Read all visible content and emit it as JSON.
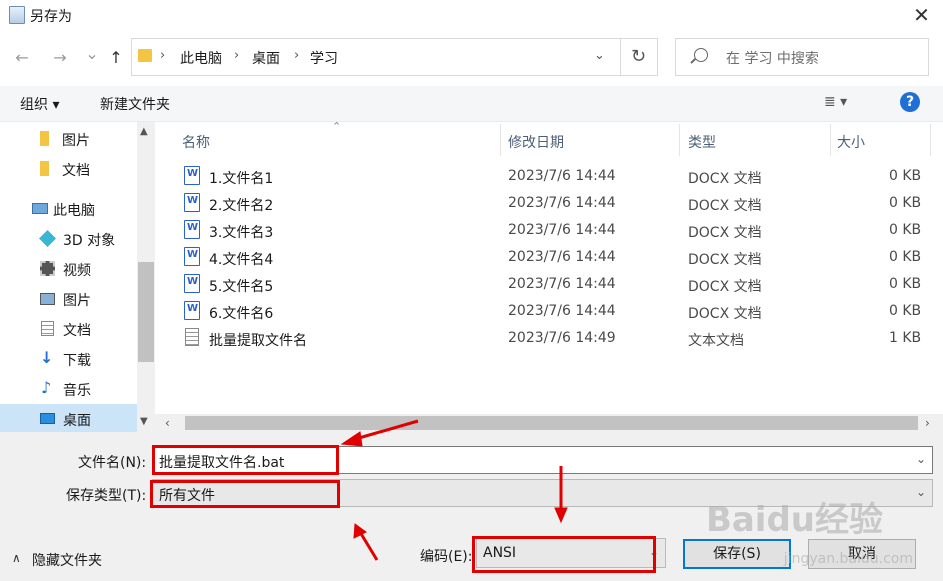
{
  "window": {
    "title": "另存为"
  },
  "nav": {
    "back": "←",
    "forward": "→",
    "dropdown": "⌄",
    "up": "↑",
    "breadcrumbs": [
      "此电脑",
      "桌面",
      "学习"
    ],
    "search_placeholder": "在 学习 中搜索"
  },
  "toolbar": {
    "organize": "组织 ▾",
    "new_folder": "新建文件夹",
    "view": "≣ ▾",
    "help": "?"
  },
  "sidebar": {
    "items": [
      {
        "label": "图片",
        "icon": "folder-icon"
      },
      {
        "label": "文档",
        "icon": "folder-icon"
      },
      {
        "label": "此电脑",
        "icon": "computer-icon"
      },
      {
        "label": "3D 对象",
        "icon": "cube-icon"
      },
      {
        "label": "视频",
        "icon": "video-icon"
      },
      {
        "label": "图片",
        "icon": "pictures-icon"
      },
      {
        "label": "文档",
        "icon": "documents-icon"
      },
      {
        "label": "下载",
        "icon": "download-icon"
      },
      {
        "label": "音乐",
        "icon": "music-icon"
      },
      {
        "label": "桌面",
        "icon": "desktop-icon",
        "selected": true
      }
    ]
  },
  "file_list": {
    "columns": [
      "名称",
      "修改日期",
      "类型",
      "大小"
    ],
    "rows": [
      {
        "name": "1.文件名1",
        "date": "2023/7/6 14:44",
        "type": "DOCX 文档",
        "size": "0 KB",
        "icon": "docx-icon"
      },
      {
        "name": "2.文件名2",
        "date": "2023/7/6 14:44",
        "type": "DOCX 文档",
        "size": "0 KB",
        "icon": "docx-icon"
      },
      {
        "name": "3.文件名3",
        "date": "2023/7/6 14:44",
        "type": "DOCX 文档",
        "size": "0 KB",
        "icon": "docx-icon"
      },
      {
        "name": "4.文件名4",
        "date": "2023/7/6 14:44",
        "type": "DOCX 文档",
        "size": "0 KB",
        "icon": "docx-icon"
      },
      {
        "name": "5.文件名5",
        "date": "2023/7/6 14:44",
        "type": "DOCX 文档",
        "size": "0 KB",
        "icon": "docx-icon"
      },
      {
        "name": "6.文件名6",
        "date": "2023/7/6 14:44",
        "type": "DOCX 文档",
        "size": "0 KB",
        "icon": "docx-icon"
      },
      {
        "name": "批量提取文件名",
        "date": "2023/7/6 14:49",
        "type": "文本文档",
        "size": "1 KB",
        "icon": "text-file-icon"
      }
    ]
  },
  "form": {
    "filename_label": "文件名(N):",
    "filename_value": "批量提取文件名.bat",
    "filetype_label": "保存类型(T):",
    "filetype_value": "所有文件",
    "encoding_label": "编码(E):",
    "encoding_value": "ANSI",
    "hide_folders": "隐藏文件夹",
    "save": "保存(S)",
    "cancel": "取消"
  },
  "watermark": {
    "main": "Baidu经验",
    "sub": "jingyan.baidu.com"
  },
  "colors": {
    "accent": "#0078d7",
    "annotation": "#e00000",
    "selected": "#cce4f7"
  }
}
